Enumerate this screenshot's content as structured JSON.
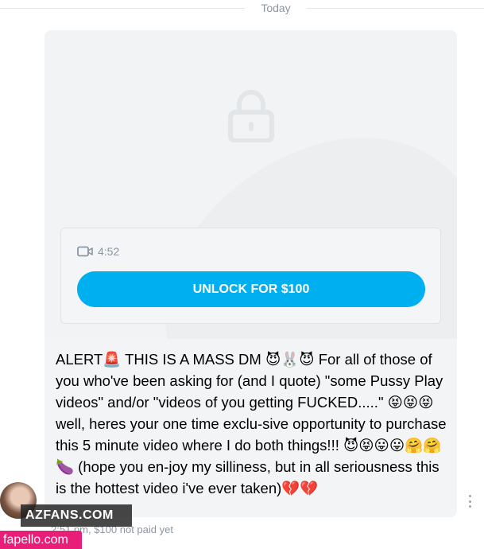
{
  "date_separator": "Today",
  "media": {
    "duration": "4:52",
    "unlock_label": "UNLOCK FOR $100"
  },
  "message": {
    "text": "ALERT🚨 THIS IS A MASS DM 😈🐰😈 For all of those of you who've been asking for (and I quote) \"some Pussy Play videos\" and/or \"videos of you getting FUCKED.....\" 😝😝😝 well, heres your one time exclu-sive opportunity to purchase this 5 minute video where I do both things!!! 😈😝😛😛🤗🤗🍆 (hope you en-joy my silliness, but in all seriousness this is the hottest video i've ever taken)💔💔",
    "meta": "2:51 pm, $100 not paid yet"
  },
  "watermarks": {
    "azfans": "AZFANS.COM",
    "fapello": "fapello.com"
  },
  "colors": {
    "accent": "#00aff0",
    "bubble": "#f2f4f5",
    "muted": "#8a96a3",
    "fapello": "#e91e79"
  }
}
